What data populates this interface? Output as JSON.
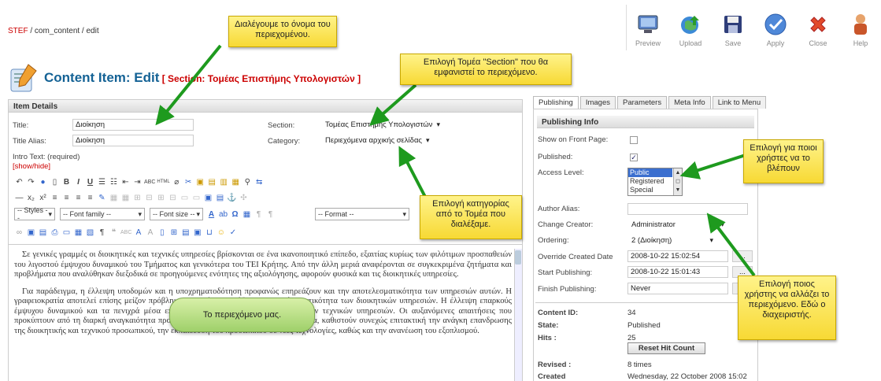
{
  "breadcrumb": {
    "root": "STEF",
    "rest": " / com_content / edit"
  },
  "toolbar": [
    {
      "label": "Preview",
      "icon": "preview-icon"
    },
    {
      "label": "Upload",
      "icon": "upload-icon"
    },
    {
      "label": "Save",
      "icon": "save-icon"
    },
    {
      "label": "Apply",
      "icon": "apply-icon"
    },
    {
      "label": "Close",
      "icon": "close-icon"
    },
    {
      "label": "Help",
      "icon": "help-icon"
    }
  ],
  "page_title": {
    "main": "Content Item: ",
    "action": "Edit",
    "section": " [ Section: Τομέας Επιστήμης Υπολογιστών ]"
  },
  "item_details": {
    "heading": "Item Details",
    "title_label": "Title:",
    "title_value": "Διοίκηση",
    "alias_label": "Title Alias:",
    "alias_value": "Διοίκηση",
    "section_label": "Section:",
    "section_value": "Τομέας Επιστήμης Υπολογιστών",
    "category_label": "Category:",
    "category_value": "Περιεχόμενα αρχικής σελίδας",
    "intro_label": "Intro Text: (required)",
    "showhide": "[show/hide]"
  },
  "editor": {
    "styles": "-- Styles --",
    "font_family": "-- Font family --",
    "font_size": "-- Font size --",
    "format": "-- Format --",
    "paragraphs": [
      "Σε γενικές γραμμές οι διοικητικές και τεχνικές υπηρεσίες βρίσκονται σε ένα ικανοποιητικό επίπεδο, εξαιτίας κυρίως των φιλότιμων προσπαθειών του λιγοστού έμψυχου δυναμικού του Τμήματος και γενικότερα του ΤΕΙ Κρήτης. Από την άλλη μεριά αναφέρονται σε συγκεκριμένα ζητήματα και προβλήματα που αναλύθηκαν διεξοδικά σε προηγούμενες ενότητες της αξιολόγησης, αφορούν φυσικά και τις διοικητικές υπηρεσίες.",
      "Για παράδειγμα, η έλλειψη υποδομών και η υποχρηματοδότηση προφανώς επηρεάζουν και την αποτελεσματικότητα των υπηρεσιών αυτών. Η γραφειοκρατία αποτελεί επίσης μείζον πρόβλημα, η οποία επηρεάζει την αποτελεσματικότητα των διοικητικών υπηρεσιών. Η έλλειψη επαρκούς έμψυχου δυναμικού και τα πενιχρά μέσα επηρεάζουν επίσης τη λειτουργικότητα των τεχνικών υπηρεσιών. Οι αυξανόμενες απαιτήσεις που προκύπτουν από τη διαρκή αναγκαιότητα προσαρμογής του Τμήματος στα νέα δεδομένα, καθιστούν συνεχώς επιτακτική την ανάγκη επανδρωσης της διοικητικής και τεχνικού προσωπικού, την εκπαίδευση του προσωπικού σε νέες τεχνολογίες, καθώς και την ανανέωση του εξοπλισμού."
    ]
  },
  "tabs": [
    "Publishing",
    "Images",
    "Parameters",
    "Meta Info",
    "Link to Menu"
  ],
  "publishing": {
    "heading": "Publishing Info",
    "front_label": "Show on Front Page:",
    "published_label": "Published:",
    "access_label": "Access Level:",
    "access_options": [
      "Public",
      "Registered",
      "Special"
    ],
    "author_alias_label": "Author Alias:",
    "creator_label": "Change Creator:",
    "creator_value": "Administrator",
    "ordering_label": "Ordering:",
    "ordering_value": "2 (Διοίκηση)",
    "override_label": "Override Created Date",
    "override_value": "2008-10-22 15:02:54",
    "start_label": "Start Publishing:",
    "start_value": "2008-10-22 15:01:43",
    "finish_label": "Finish Publishing:",
    "finish_value": "Never",
    "date_btn": "..."
  },
  "info": {
    "content_id_label": "Content ID:",
    "content_id": "34",
    "state_label": "State:",
    "state": "Published",
    "hits_label": "Hits :",
    "hits": "25",
    "reset_btn": "Reset Hit Count",
    "revised_label": "Revised :",
    "revised": "8 times",
    "created_label": "Created",
    "created": "Wednesday, 22 October 2008 15:02"
  },
  "callouts": {
    "name": "Διαλέγουμε το όνομα του περιεχομένου.",
    "section": "Επιλογή Τομέα \"Section\" που θα εμφανιστεί το περιεχόμενο.",
    "category": "Επιλογή κατηγορίας από το Τομέα που διαλέξαμε.",
    "access": "Επιλογή για ποιοι χρήστες να το βλέπουν",
    "creator": "Επιλογή ποιος χρήστης να αλλάζει το περιεχόμενο. Εδώ ο διαχειριστής.",
    "content": "Το περιεχόμενο μας."
  },
  "colors": {
    "title": "#146295",
    "accent_red": "#cc0000",
    "arrow": "#1e9a1e",
    "callout": "#f7d934"
  }
}
